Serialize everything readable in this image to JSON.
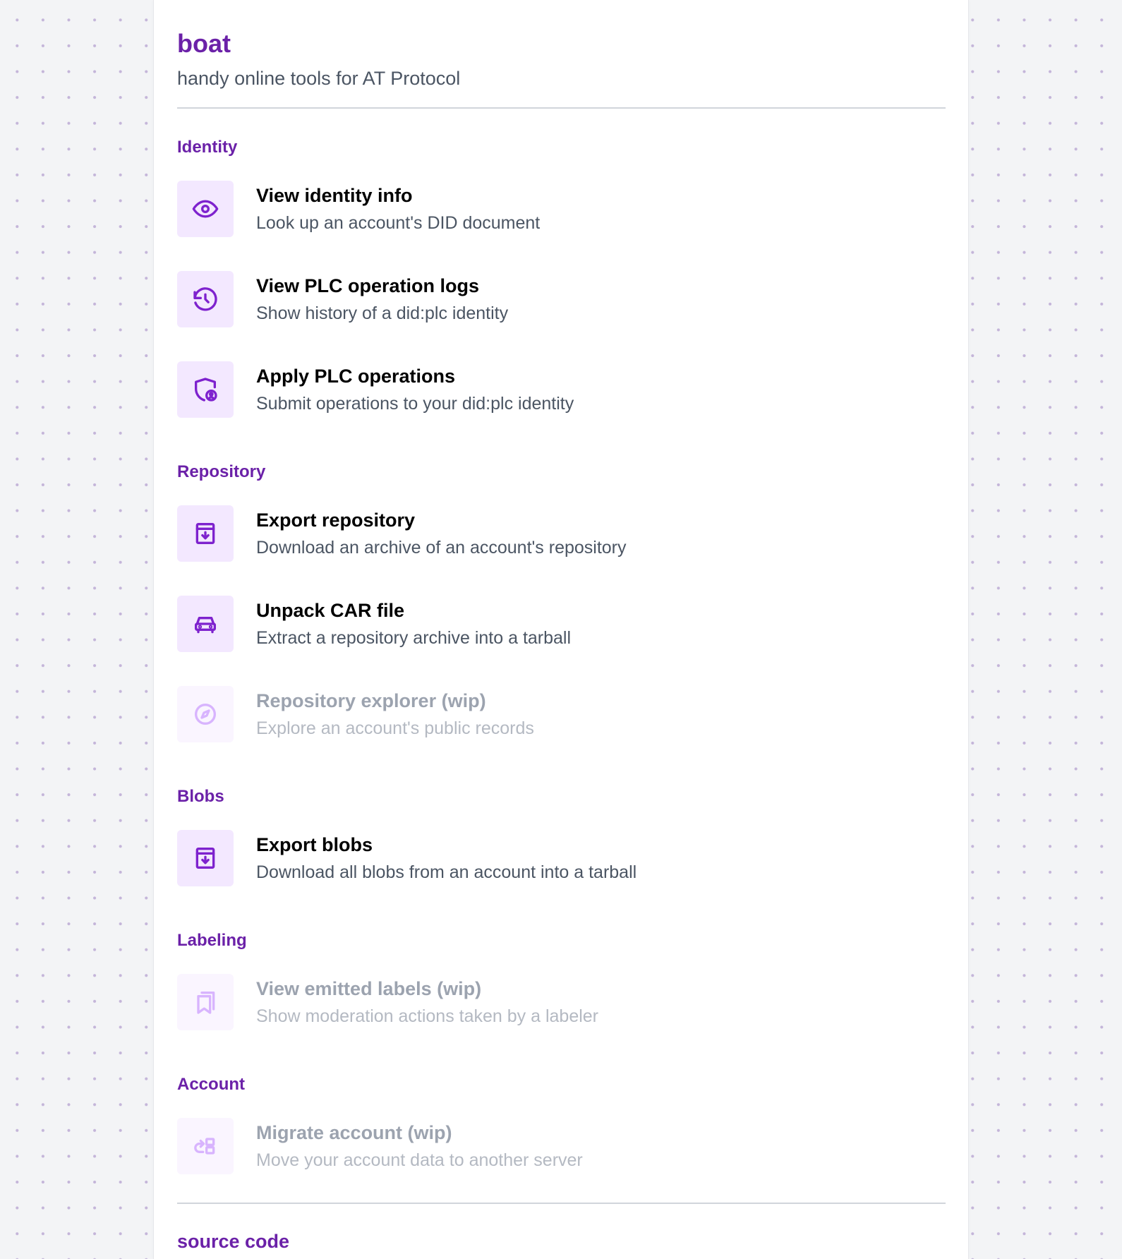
{
  "header": {
    "title": "boat",
    "subtitle": "handy online tools for AT Protocol"
  },
  "sections": [
    {
      "title": "Identity",
      "tools": [
        {
          "name": "View identity info",
          "description": "Look up an account's DID document",
          "icon": "eye-icon",
          "disabled": false
        },
        {
          "name": "View PLC operation logs",
          "description": "Show history of a did:plc identity",
          "icon": "history-icon",
          "disabled": false
        },
        {
          "name": "Apply PLC operations",
          "description": "Submit operations to your did:plc identity",
          "icon": "shield-user-icon",
          "disabled": false
        }
      ]
    },
    {
      "title": "Repository",
      "tools": [
        {
          "name": "Export repository",
          "description": "Download an archive of an account's repository",
          "icon": "archive-download-icon",
          "disabled": false
        },
        {
          "name": "Unpack CAR file",
          "description": "Extract a repository archive into a tarball",
          "icon": "car-icon",
          "disabled": false
        },
        {
          "name": "Repository explorer (wip)",
          "description": "Explore an account's public records",
          "icon": "compass-icon",
          "disabled": true
        }
      ]
    },
    {
      "title": "Blobs",
      "tools": [
        {
          "name": "Export blobs",
          "description": "Download all blobs from an account into a tarball",
          "icon": "archive-download-icon",
          "disabled": false
        }
      ]
    },
    {
      "title": "Labeling",
      "tools": [
        {
          "name": "View emitted labels (wip)",
          "description": "Show moderation actions taken by a labeler",
          "icon": "bookmarks-icon",
          "disabled": true
        }
      ]
    },
    {
      "title": "Account",
      "tools": [
        {
          "name": "Migrate account (wip)",
          "description": "Move your account data to another server",
          "icon": "migrate-icon",
          "disabled": true
        }
      ]
    }
  ],
  "footer": {
    "title": "source code"
  }
}
